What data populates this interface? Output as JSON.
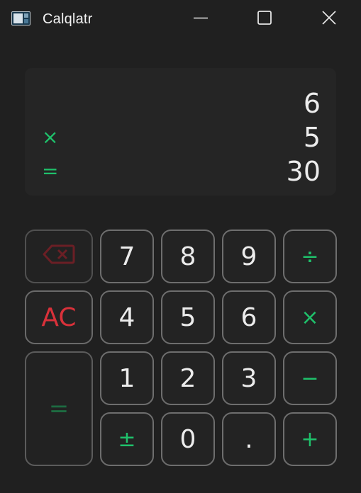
{
  "window": {
    "title": "Calqlatr",
    "icon": "app-icon",
    "controls": [
      "minimize-icon",
      "maximize-icon",
      "close-icon"
    ]
  },
  "display": {
    "rows": [
      {
        "operator": "",
        "value": "6"
      },
      {
        "operator": "×",
        "value": "5"
      },
      {
        "operator": "=",
        "value": "30"
      }
    ]
  },
  "keypad": {
    "backspace": {
      "icon": "backspace-icon"
    },
    "ac": "AC",
    "equals": "=",
    "digits": {
      "seven": "7",
      "eight": "8",
      "nine": "9",
      "four": "4",
      "five": "5",
      "six": "6",
      "one": "1",
      "two": "2",
      "three": "3",
      "zero": "0"
    },
    "plus_minus": "±",
    "point": ".",
    "divide": "÷",
    "multiply": "×",
    "minus": "−",
    "plus": "+"
  },
  "colors": {
    "background": "#202020",
    "display_bg": "#252525",
    "accent_green": "#1fc16b",
    "accent_red": "#d9313a",
    "key_border": "#6e6e6e"
  }
}
